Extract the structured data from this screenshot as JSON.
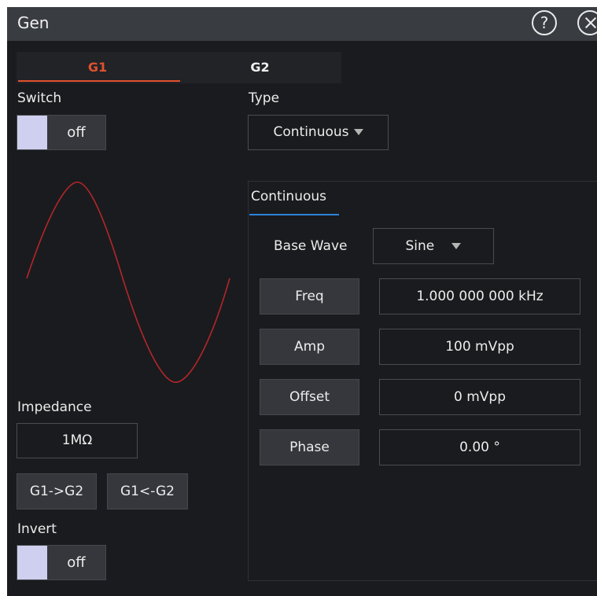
{
  "window": {
    "title": "Gen",
    "help_glyph": "?"
  },
  "tabs": [
    {
      "label": "G1",
      "active": true
    },
    {
      "label": "G2",
      "active": false
    }
  ],
  "switch": {
    "label": "Switch",
    "state": "off"
  },
  "type": {
    "label": "Type",
    "value": "Continuous"
  },
  "continuous": {
    "tab_label": "Continuous",
    "base_wave": {
      "label": "Base Wave",
      "value": "Sine"
    },
    "freq": {
      "label": "Freq",
      "value": "1.000 000 000 kHz"
    },
    "amp": {
      "label": "Amp",
      "value": "100 mVpp"
    },
    "offset": {
      "label": "Offset",
      "value": "0 mVpp"
    },
    "phase": {
      "label": "Phase",
      "value": "0.00 °"
    }
  },
  "impedance": {
    "label": "Impedance",
    "value": "1MΩ"
  },
  "copy": {
    "to_g2": "G1->G2",
    "from_g2": "G1<-G2"
  },
  "invert": {
    "label": "Invert",
    "state": "off"
  },
  "colors": {
    "accent_active_tab": "#e0512d",
    "sub_tab_underline": "#2d84d9",
    "wave": "#b3262a",
    "background": "#1a1b1e"
  },
  "icons": {
    "help": "help-icon",
    "close": "close-icon",
    "dropdown": "caret-down-icon"
  }
}
